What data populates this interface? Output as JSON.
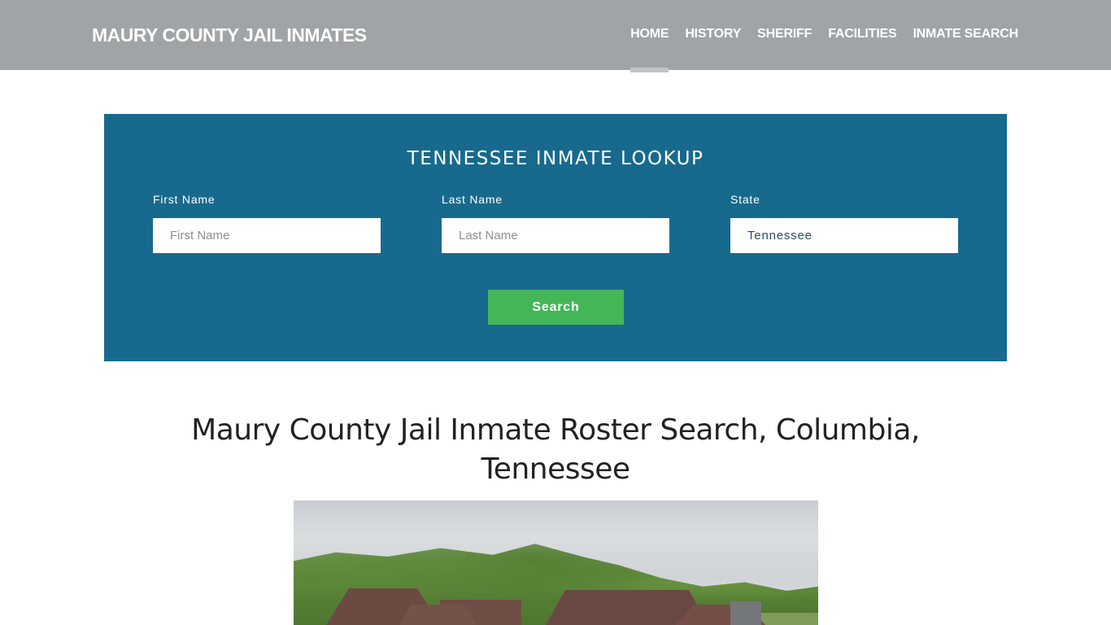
{
  "header": {
    "brand": "MAURY COUNTY JAIL INMATES",
    "nav": [
      {
        "label": "HOME",
        "active": true
      },
      {
        "label": "HISTORY",
        "active": false
      },
      {
        "label": "SHERIFF",
        "active": false
      },
      {
        "label": "FACILITIES",
        "active": false
      },
      {
        "label": "INMATE SEARCH",
        "active": false
      }
    ]
  },
  "lookup": {
    "title": "TENNESSEE INMATE LOOKUP",
    "first_name": {
      "label": "First Name",
      "placeholder": "First Name",
      "value": ""
    },
    "last_name": {
      "label": "Last Name",
      "placeholder": "Last Name",
      "value": ""
    },
    "state": {
      "label": "State",
      "value": "Tennessee"
    },
    "search_label": "Search"
  },
  "main": {
    "title": "Maury County Jail Inmate Roster Search, Columbia, Tennessee",
    "image_alt": "Maury County Jail building photo"
  },
  "colors": {
    "header_bg": "#a0a4a7",
    "lookup_bg": "#176a8d",
    "search_button": "#44b658"
  }
}
